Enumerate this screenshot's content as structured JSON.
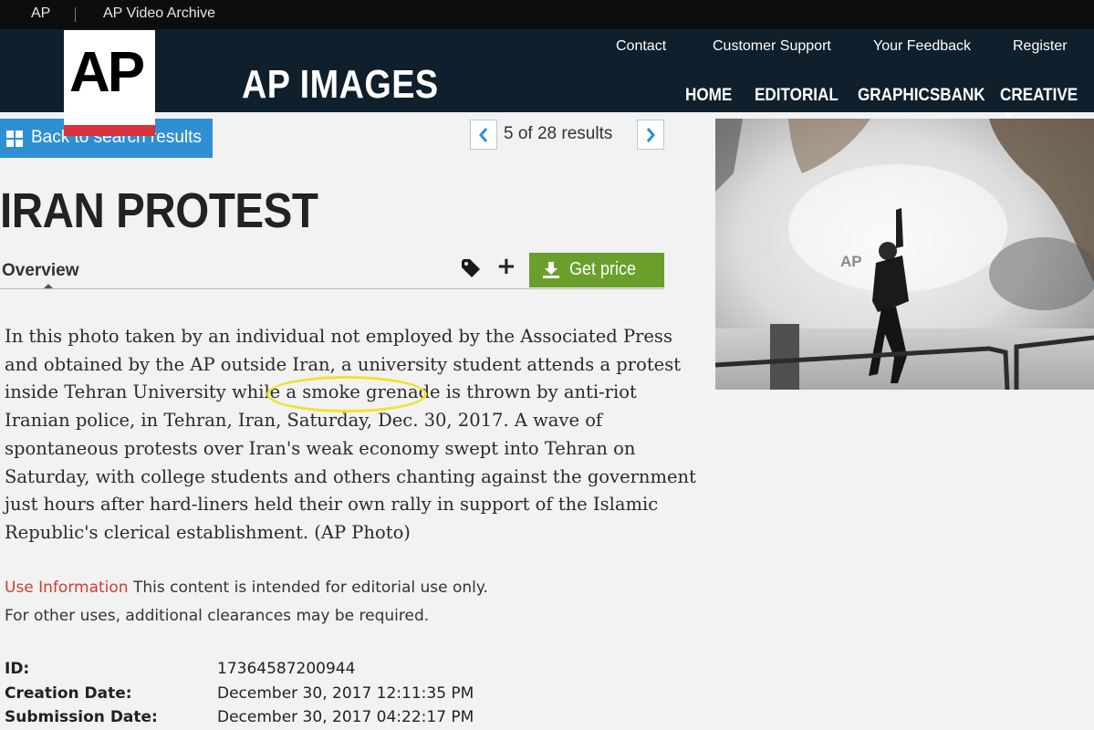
{
  "topbar": {
    "ap_link": "AP",
    "video_link": "AP Video Archive"
  },
  "header": {
    "logo": "AP",
    "brand": "AP IMAGES",
    "links": {
      "contact": "Contact",
      "support": "Customer Support",
      "feedback": "Your Feedback",
      "register": "Register"
    },
    "nav": {
      "home": "HOME",
      "editorial": "EDITORIAL",
      "graphicsbank": "GRAPHICSBANK",
      "creative": "CREATIVE"
    }
  },
  "back_button": {
    "label": "Back to search results"
  },
  "pager": {
    "prev_icon": "chevron-left-icon",
    "next_icon": "chevron-right-icon",
    "text": "5 of 28 results"
  },
  "title": "IRAN PROTEST",
  "tabs": {
    "overview": "Overview"
  },
  "actions": {
    "tag_icon": "tag-icon",
    "add_icon": "plus-icon",
    "get_price": "Get price",
    "price_color": "#6a9f2c"
  },
  "caption": {
    "lines": [
      "In this photo taken by an individual not employed by the Associated Press",
      "and obtained by the AP outside Iran, a university student attends a protest",
      "inside Tehran University while a smoke grenade is thrown by anti-riot",
      "Iranian police, in Tehran, Iran, Saturday, Dec. 30, 2017. A wave of",
      "spontaneous protests over Iran's weak economy swept into Tehran on",
      "Saturday, with college students and others chanting against the government",
      "just hours after hard-liners held their own rally in support of the Islamic",
      "Republic's clerical establishment. (AP Photo)"
    ],
    "highlight_color": "#f0e32a"
  },
  "use_info": {
    "label": "Use Information",
    "text": "This content is intended for editorial use only.",
    "text2": "For other uses, additional clearances may be required."
  },
  "metadata": {
    "id_label": "ID:",
    "id_value": "17364587200944",
    "creation_label": "Creation Date:",
    "creation_value": "December 30, 2017 12:11:35 PM",
    "submission_label": "Submission Date:",
    "submission_value": "December 30, 2017 04:22:17 PM"
  },
  "photo": {
    "watermark": "AP"
  }
}
